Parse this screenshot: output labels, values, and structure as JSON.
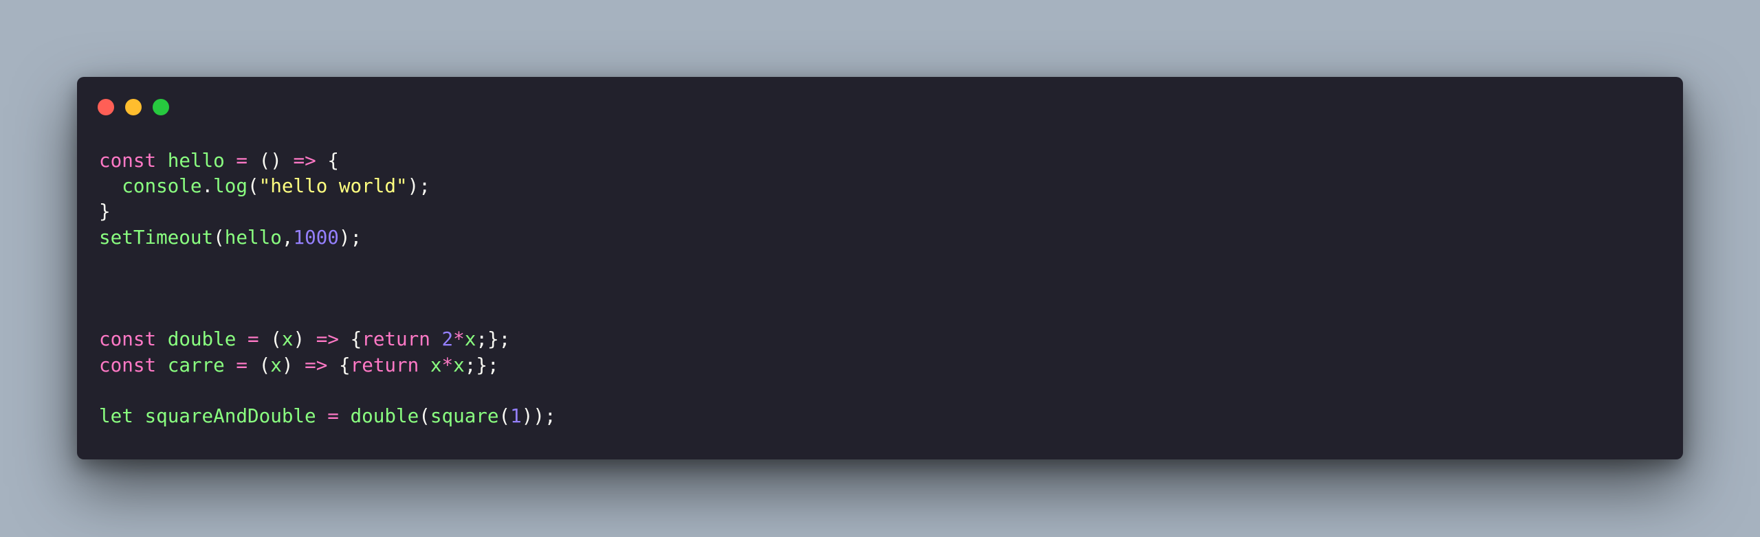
{
  "window": {
    "controls": [
      {
        "name": "close",
        "color": "#ff5f56"
      },
      {
        "name": "minimize",
        "color": "#ffbd2e"
      },
      {
        "name": "maximize",
        "color": "#27c93f"
      }
    ]
  },
  "theme": {
    "background": "#a6b2bf",
    "editor_bg": "#22212c",
    "keyword": "#ff79c6",
    "function": "#8aff80",
    "plain": "#f8f8f2",
    "string": "#ffff80",
    "number": "#9580ff"
  },
  "code": {
    "lines": [
      [
        {
          "t": "kw",
          "v": "const"
        },
        {
          "t": "pl",
          "v": " "
        },
        {
          "t": "fn",
          "v": "hello"
        },
        {
          "t": "pl",
          "v": " "
        },
        {
          "t": "kw",
          "v": "="
        },
        {
          "t": "pl",
          "v": " () "
        },
        {
          "t": "kw",
          "v": "=>"
        },
        {
          "t": "pl",
          "v": " {"
        }
      ],
      [
        {
          "t": "pl",
          "v": "  "
        },
        {
          "t": "fn",
          "v": "console"
        },
        {
          "t": "pl",
          "v": "."
        },
        {
          "t": "fn",
          "v": "log"
        },
        {
          "t": "pl",
          "v": "("
        },
        {
          "t": "str",
          "v": "\"hello world\""
        },
        {
          "t": "pl",
          "v": ");"
        }
      ],
      [
        {
          "t": "pl",
          "v": "}"
        }
      ],
      [
        {
          "t": "fn",
          "v": "setTimeout"
        },
        {
          "t": "pl",
          "v": "("
        },
        {
          "t": "fn",
          "v": "hello"
        },
        {
          "t": "pl",
          "v": ","
        },
        {
          "t": "num",
          "v": "1000"
        },
        {
          "t": "pl",
          "v": ");"
        }
      ],
      [],
      [],
      [],
      [
        {
          "t": "kw",
          "v": "const"
        },
        {
          "t": "pl",
          "v": " "
        },
        {
          "t": "fn",
          "v": "double"
        },
        {
          "t": "pl",
          "v": " "
        },
        {
          "t": "kw",
          "v": "="
        },
        {
          "t": "pl",
          "v": " ("
        },
        {
          "t": "fn",
          "v": "x"
        },
        {
          "t": "pl",
          "v": ") "
        },
        {
          "t": "kw",
          "v": "=>"
        },
        {
          "t": "pl",
          "v": " {"
        },
        {
          "t": "kw",
          "v": "return"
        },
        {
          "t": "pl",
          "v": " "
        },
        {
          "t": "num",
          "v": "2"
        },
        {
          "t": "kw",
          "v": "*"
        },
        {
          "t": "fn",
          "v": "x"
        },
        {
          "t": "pl",
          "v": ";};"
        }
      ],
      [
        {
          "t": "kw",
          "v": "const"
        },
        {
          "t": "pl",
          "v": " "
        },
        {
          "t": "fn",
          "v": "carre"
        },
        {
          "t": "pl",
          "v": " "
        },
        {
          "t": "kw",
          "v": "="
        },
        {
          "t": "pl",
          "v": " ("
        },
        {
          "t": "fn",
          "v": "x"
        },
        {
          "t": "pl",
          "v": ") "
        },
        {
          "t": "kw",
          "v": "=>"
        },
        {
          "t": "pl",
          "v": " {"
        },
        {
          "t": "kw",
          "v": "return"
        },
        {
          "t": "pl",
          "v": " "
        },
        {
          "t": "fn",
          "v": "x"
        },
        {
          "t": "kw",
          "v": "*"
        },
        {
          "t": "fn",
          "v": "x"
        },
        {
          "t": "pl",
          "v": ";};"
        }
      ],
      [],
      [
        {
          "t": "fn",
          "v": "let"
        },
        {
          "t": "pl",
          "v": " "
        },
        {
          "t": "fn",
          "v": "squareAndDouble"
        },
        {
          "t": "pl",
          "v": " "
        },
        {
          "t": "kw",
          "v": "="
        },
        {
          "t": "pl",
          "v": " "
        },
        {
          "t": "fn",
          "v": "double"
        },
        {
          "t": "pl",
          "v": "("
        },
        {
          "t": "fn",
          "v": "square"
        },
        {
          "t": "pl",
          "v": "("
        },
        {
          "t": "num",
          "v": "1"
        },
        {
          "t": "pl",
          "v": "));"
        }
      ]
    ]
  }
}
